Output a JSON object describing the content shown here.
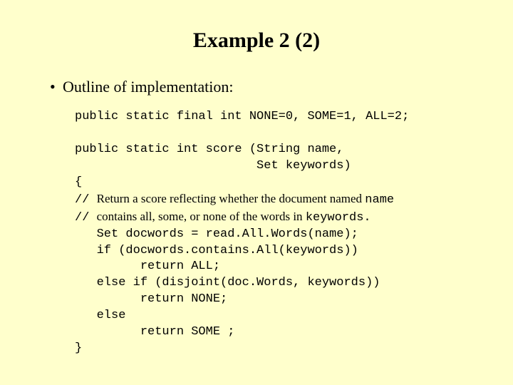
{
  "title": "Example 2 (2)",
  "bullet": "Outline of implementation:",
  "code": {
    "l1": "public static final int NONE=0, SOME=1, ALL=2;",
    "l2": "",
    "l3": "public static int score (String name,",
    "l4": "                         Set keywords)",
    "l5": "{",
    "c1a": "// ",
    "c1b": "Return a score reflecting whether the document named ",
    "c1c": "name",
    "c2a": "// ",
    "c2b": "contains all, some, or none of the words in ",
    "c2c": "keywords.",
    "l8": "   Set docwords = read.All.Words(name);",
    "l9": "   if (docwords.contains.All(keywords))",
    "l10": "         return ALL;",
    "l11": "   else if (disjoint(doc.Words, keywords))",
    "l12": "         return NONE;",
    "l13": "   else",
    "l14": "         return SOME ;",
    "l15": "}"
  }
}
